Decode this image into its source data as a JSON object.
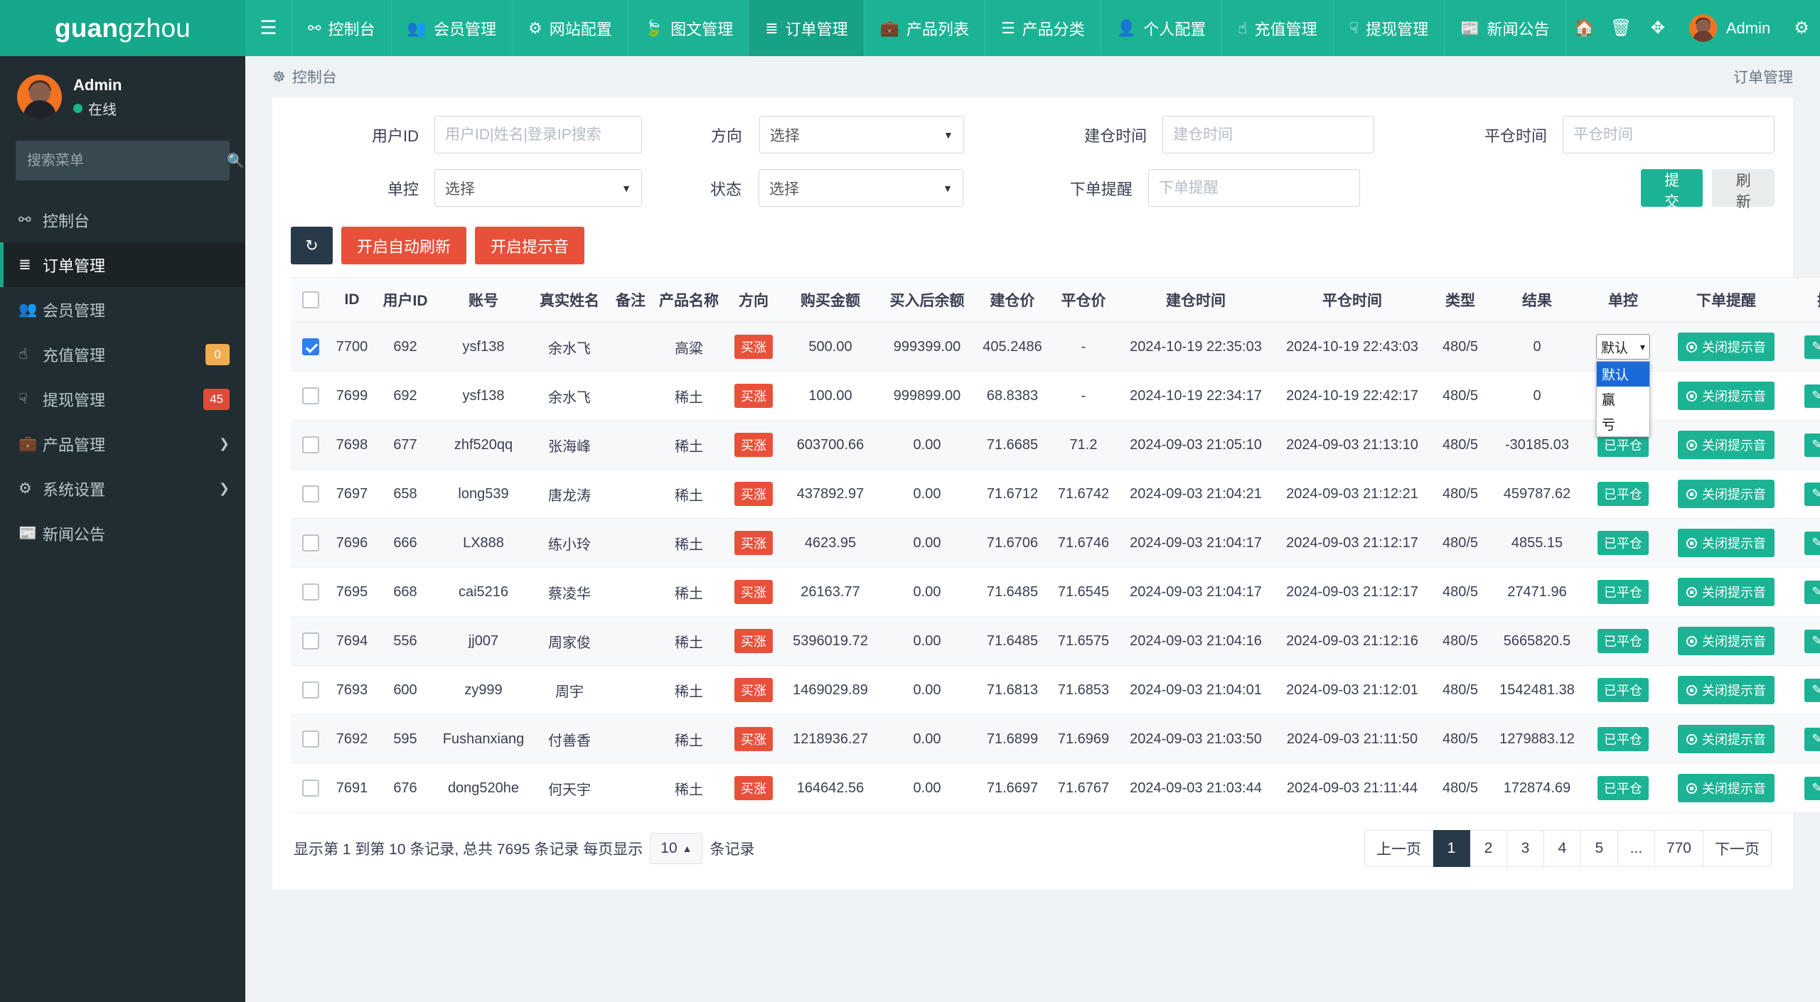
{
  "brand": {
    "bold": "guan",
    "rest": "gzhou"
  },
  "profile": {
    "name": "Admin",
    "status": "在线"
  },
  "sidebar": {
    "search_placeholder": "搜索菜单",
    "items": [
      {
        "label": "控制台",
        "icon": "dashboard-icon",
        "badge": "",
        "active": false,
        "caret": false
      },
      {
        "label": "订单管理",
        "icon": "order-list-icon",
        "badge": "",
        "active": true,
        "caret": false
      },
      {
        "label": "会员管理",
        "icon": "users-icon",
        "badge": "",
        "active": false,
        "caret": false
      },
      {
        "label": "充值管理",
        "icon": "hand-up-icon",
        "badge": "0",
        "active": false,
        "caret": false,
        "badge_color": "orange"
      },
      {
        "label": "提现管理",
        "icon": "hand-down-icon",
        "badge": "45",
        "active": false,
        "caret": false,
        "badge_color": "red"
      },
      {
        "label": "产品管理",
        "icon": "briefcase-icon",
        "badge": "",
        "active": false,
        "caret": true
      },
      {
        "label": "系统设置",
        "icon": "gears-icon",
        "badge": "",
        "active": false,
        "caret": true
      },
      {
        "label": "新闻公告",
        "icon": "news-icon",
        "badge": "",
        "active": false,
        "caret": false
      }
    ]
  },
  "topbar": {
    "hamburger": "hamburger-icon",
    "items": [
      {
        "label": "控制台",
        "icon": "dashboard-icon",
        "active": false
      },
      {
        "label": "会员管理",
        "icon": "users-icon",
        "active": false
      },
      {
        "label": "网站配置",
        "icon": "gear-icon",
        "active": false
      },
      {
        "label": "图文管理",
        "icon": "leaf-icon",
        "active": false
      },
      {
        "label": "订单管理",
        "icon": "order-list-icon",
        "active": true
      },
      {
        "label": "产品列表",
        "icon": "briefcase-icon",
        "active": false
      },
      {
        "label": "产品分类",
        "icon": "list-alt-icon",
        "active": false
      },
      {
        "label": "个人配置",
        "icon": "user-icon",
        "active": false
      },
      {
        "label": "充值管理",
        "icon": "hand-up-icon",
        "active": false
      },
      {
        "label": "提现管理",
        "icon": "hand-down-icon",
        "active": false
      },
      {
        "label": "新闻公告",
        "icon": "news-icon",
        "active": false
      }
    ],
    "right_icons": [
      "home-icon",
      "trash-icon",
      "fullscreen-icon"
    ],
    "user_name": "Admin",
    "settings_icon": "gears-icon"
  },
  "breadcrumb": {
    "icon": "dashboard-icon",
    "text": "控制台",
    "right": "订单管理"
  },
  "filters": {
    "user_id_label": "用户ID",
    "user_id_placeholder": "用户ID|姓名|登录IP搜索",
    "user_id_value": "",
    "direction_label": "方向",
    "direction_value": "选择",
    "open_time_label": "建仓时间",
    "open_time_placeholder": "建仓时间",
    "open_time_value": "",
    "close_time_label": "平仓时间",
    "close_time_placeholder": "平仓时间",
    "close_time_value": "",
    "single_ctrl_label": "单控",
    "single_ctrl_value": "选择",
    "status_label": "状态",
    "status_value": "选择",
    "order_note_label": "下单提醒",
    "order_note_placeholder": "下单提醒",
    "order_note_value": "",
    "submit_label": "提交",
    "refresh_label": "刷新"
  },
  "actions": {
    "reload_icon": "refresh-icon",
    "auto_refresh_label": "开启自动刷新",
    "sound_label": "开启提示音"
  },
  "table": {
    "headers": [
      "",
      "ID",
      "用户ID",
      "账号",
      "真实姓名",
      "备注",
      "产品名称",
      "方向",
      "购买金额",
      "买入后余额",
      "建仓价",
      "平仓价",
      "建仓时间",
      "平仓时间",
      "类型",
      "结果",
      "单控",
      "下单提醒",
      "操作"
    ],
    "close_tone_label": "关闭提示音",
    "single_ctrl_current": "默认",
    "single_ctrl_options": [
      "默认",
      "赢",
      "亏"
    ],
    "rows": [
      {
        "checked": true,
        "id": "7700",
        "uid": "692",
        "account": "ysf138",
        "realname": "余水飞",
        "note": "",
        "product": "高粱",
        "direction": "买涨",
        "amount": "500.00",
        "balance": "999399.00",
        "open_price": "405.2486",
        "close_price": "-",
        "open_time": "2024-10-19 22:35:03",
        "close_time": "2024-10-19 22:43:03",
        "type": "480/5",
        "result": "0",
        "status": ""
      },
      {
        "checked": false,
        "id": "7699",
        "uid": "692",
        "account": "ysf138",
        "realname": "余水飞",
        "note": "",
        "product": "稀土",
        "direction": "买涨",
        "amount": "100.00",
        "balance": "999899.00",
        "open_price": "68.8383",
        "close_price": "-",
        "open_time": "2024-10-19 22:34:17",
        "close_time": "2024-10-19 22:42:17",
        "type": "480/5",
        "result": "0",
        "status": ""
      },
      {
        "checked": false,
        "id": "7698",
        "uid": "677",
        "account": "zhf520qq",
        "realname": "张海峰",
        "note": "",
        "product": "稀土",
        "direction": "买涨",
        "amount": "603700.66",
        "balance": "0.00",
        "open_price": "71.6685",
        "close_price": "71.2",
        "open_time": "2024-09-03 21:05:10",
        "close_time": "2024-09-03 21:13:10",
        "type": "480/5",
        "result": "-30185.03",
        "status": "已平仓"
      },
      {
        "checked": false,
        "id": "7697",
        "uid": "658",
        "account": "long539",
        "realname": "唐龙涛",
        "note": "",
        "product": "稀土",
        "direction": "买涨",
        "amount": "437892.97",
        "balance": "0.00",
        "open_price": "71.6712",
        "close_price": "71.6742",
        "open_time": "2024-09-03 21:04:21",
        "close_time": "2024-09-03 21:12:21",
        "type": "480/5",
        "result": "459787.62",
        "status": "已平仓"
      },
      {
        "checked": false,
        "id": "7696",
        "uid": "666",
        "account": "LX888",
        "realname": "练小玲",
        "note": "",
        "product": "稀土",
        "direction": "买涨",
        "amount": "4623.95",
        "balance": "0.00",
        "open_price": "71.6706",
        "close_price": "71.6746",
        "open_time": "2024-09-03 21:04:17",
        "close_time": "2024-09-03 21:12:17",
        "type": "480/5",
        "result": "4855.15",
        "status": "已平仓"
      },
      {
        "checked": false,
        "id": "7695",
        "uid": "668",
        "account": "cai5216",
        "realname": "蔡凌华",
        "note": "",
        "product": "稀土",
        "direction": "买涨",
        "amount": "26163.77",
        "balance": "0.00",
        "open_price": "71.6485",
        "close_price": "71.6545",
        "open_time": "2024-09-03 21:04:17",
        "close_time": "2024-09-03 21:12:17",
        "type": "480/5",
        "result": "27471.96",
        "status": "已平仓"
      },
      {
        "checked": false,
        "id": "7694",
        "uid": "556",
        "account": "jj007",
        "realname": "周家俊",
        "note": "",
        "product": "稀土",
        "direction": "买涨",
        "amount": "5396019.72",
        "balance": "0.00",
        "open_price": "71.6485",
        "close_price": "71.6575",
        "open_time": "2024-09-03 21:04:16",
        "close_time": "2024-09-03 21:12:16",
        "type": "480/5",
        "result": "5665820.5",
        "status": "已平仓"
      },
      {
        "checked": false,
        "id": "7693",
        "uid": "600",
        "account": "zy999",
        "realname": "周宇",
        "note": "",
        "product": "稀土",
        "direction": "买涨",
        "amount": "1469029.89",
        "balance": "0.00",
        "open_price": "71.6813",
        "close_price": "71.6853",
        "open_time": "2024-09-03 21:04:01",
        "close_time": "2024-09-03 21:12:01",
        "type": "480/5",
        "result": "1542481.38",
        "status": "已平仓"
      },
      {
        "checked": false,
        "id": "7692",
        "uid": "595",
        "account": "Fushanxiang",
        "realname": "付善香",
        "note": "",
        "product": "稀土",
        "direction": "买涨",
        "amount": "1218936.27",
        "balance": "0.00",
        "open_price": "71.6899",
        "close_price": "71.6969",
        "open_time": "2024-09-03 21:03:50",
        "close_time": "2024-09-03 21:11:50",
        "type": "480/5",
        "result": "1279883.12",
        "status": "已平仓"
      },
      {
        "checked": false,
        "id": "7691",
        "uid": "676",
        "account": "dong520he",
        "realname": "何天宇",
        "note": "",
        "product": "稀土",
        "direction": "买涨",
        "amount": "164642.56",
        "balance": "0.00",
        "open_price": "71.6697",
        "close_price": "71.6767",
        "open_time": "2024-09-03 21:03:44",
        "close_time": "2024-09-03 21:11:44",
        "type": "480/5",
        "result": "172874.69",
        "status": "已平仓"
      }
    ]
  },
  "footer": {
    "info_pre": "显示第 1 到第 10 条记录, 总共 7695 条记录 每页显示",
    "per_page": "10",
    "info_post": "条记录",
    "pager": [
      "上一页",
      "1",
      "2",
      "3",
      "4",
      "5",
      "...",
      "770",
      "下一页"
    ],
    "current_page": "1"
  }
}
